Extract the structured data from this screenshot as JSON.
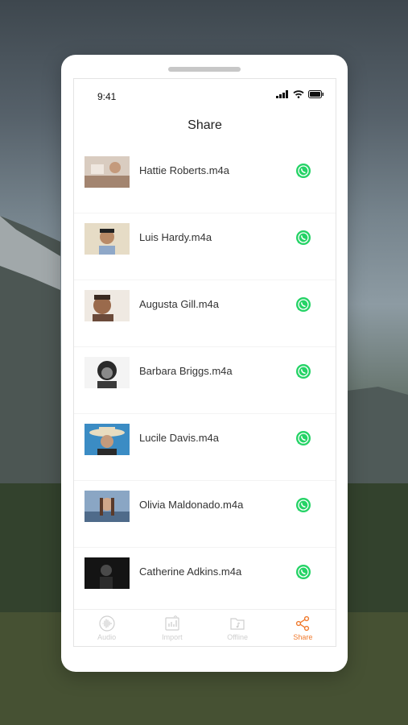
{
  "status_bar": {
    "time": "9:41"
  },
  "header": {
    "title": "Share"
  },
  "files": [
    {
      "name": "Hattie Roberts.m4a",
      "share_icon": "whatsapp-icon"
    },
    {
      "name": "Luis Hardy.m4a",
      "share_icon": "whatsapp-icon"
    },
    {
      "name": "Augusta Gill.m4a",
      "share_icon": "whatsapp-icon"
    },
    {
      "name": "Barbara Briggs.m4a",
      "share_icon": "whatsapp-icon"
    },
    {
      "name": "Lucile Davis.m4a",
      "share_icon": "whatsapp-icon"
    },
    {
      "name": "Olivia Maldonado.m4a",
      "share_icon": "whatsapp-icon"
    },
    {
      "name": "Catherine Adkins.m4a",
      "share_icon": "whatsapp-icon"
    }
  ],
  "tabbar": {
    "tabs": [
      {
        "label": "Audio",
        "icon": "audio-wave-icon",
        "active": false
      },
      {
        "label": "Import",
        "icon": "import-icon",
        "active": false
      },
      {
        "label": "Offline",
        "icon": "offline-folder-icon",
        "active": false
      },
      {
        "label": "Share",
        "icon": "share-icon",
        "active": true
      }
    ]
  },
  "colors": {
    "accent": "#f07a2d",
    "whatsapp": "#25d366",
    "inactive_tab": "#cfcfcf"
  }
}
